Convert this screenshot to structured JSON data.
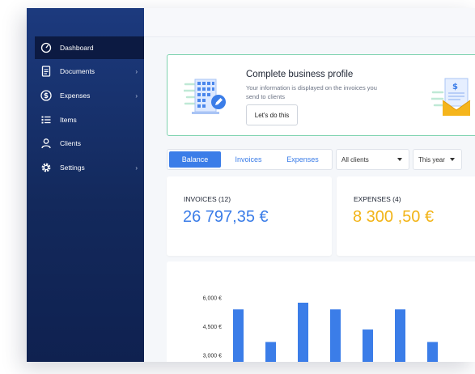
{
  "sidebar": {
    "items": [
      {
        "label": "Dashboard",
        "icon": "speedometer-icon",
        "active": true,
        "has_children": false
      },
      {
        "label": "Documents",
        "icon": "document-icon",
        "active": false,
        "has_children": true
      },
      {
        "label": "Expenses",
        "icon": "dollar-circle-icon",
        "active": false,
        "has_children": true
      },
      {
        "label": "Items",
        "icon": "list-icon",
        "active": false,
        "has_children": false
      },
      {
        "label": "Clients",
        "icon": "user-icon",
        "active": false,
        "has_children": false
      },
      {
        "label": "Settings",
        "icon": "gear-icon",
        "active": false,
        "has_children": true
      }
    ],
    "chevron": "›"
  },
  "promo": {
    "title": "Complete business profile",
    "subtitle": "Your information is displayed on the invoices you send to clients",
    "button": "Let's do this"
  },
  "tabs": [
    {
      "label": "Balance",
      "active": true
    },
    {
      "label": "Invoices",
      "active": false
    },
    {
      "label": "Expenses",
      "active": false
    }
  ],
  "filters": {
    "clients": "All clients",
    "period": "This year"
  },
  "kpis": {
    "invoices": {
      "label": "INVOICES (12)",
      "value": "26 797,35 €",
      "color": "#3b7de8"
    },
    "expenses": {
      "label": "EXPENSES (4)",
      "value": "8 300 ,50 €",
      "color": "#f2b418"
    }
  },
  "colors": {
    "accent": "#3b7de8",
    "sidebar": "#1c3a7e",
    "promo_border": "#7fd3b0",
    "expenses": "#f2b418"
  },
  "chart_data": {
    "type": "bar",
    "yticks": [
      "6,000 €",
      "4,500 €",
      "3,000 €"
    ],
    "ytick_values": [
      6000,
      4500,
      3000
    ],
    "values": [
      5400,
      3700,
      5750,
      5400,
      4350,
      5400,
      3700
    ],
    "bar_color": "#3b7de8",
    "grid": false
  }
}
